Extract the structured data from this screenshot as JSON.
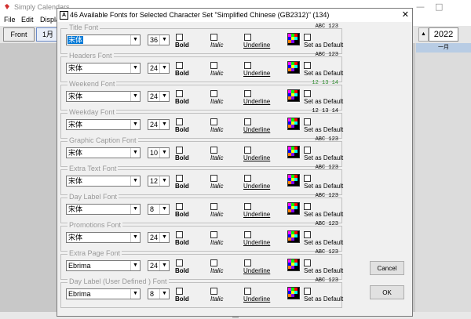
{
  "app": {
    "title": "Simply Calendars",
    "menu": [
      "File",
      "Edit",
      "Display"
    ],
    "front_label": "Front",
    "month_label": "1月",
    "year": "2022",
    "cal_header": "一月",
    "win_min": "—",
    "win_max": "□"
  },
  "dialog": {
    "title": "46 Available Fonts for Selected Character Set \"Simplified Chinese (GB2312)\" (134)",
    "icon_letter": "A",
    "close": "✕",
    "labels": {
      "bold": "Bold",
      "italic": "Italic",
      "underline": "Underline",
      "set_default": "Set as Default"
    },
    "sections": [
      {
        "name": "Title Font",
        "font": "宋体",
        "size": "36",
        "preview": "ABC 123",
        "preview_color": "#000000",
        "selected": true
      },
      {
        "name": "Headers Font",
        "font": "宋体",
        "size": "24",
        "preview": "ABC 123",
        "preview_color": "#000000",
        "selected": false
      },
      {
        "name": "Weekend Font",
        "font": "宋体",
        "size": "24",
        "preview": "12 13 14",
        "preview_color": "#2a8a2a",
        "selected": false
      },
      {
        "name": "Weekday Font",
        "font": "宋体",
        "size": "24",
        "preview": "12 13 14",
        "preview_color": "#000000",
        "selected": false
      },
      {
        "name": "Graphic Caption Font",
        "font": "宋体",
        "size": "10",
        "preview": "ABC 123",
        "preview_color": "#000000",
        "selected": false
      },
      {
        "name": "Extra Text Font",
        "font": "宋体",
        "size": "12",
        "preview": "ABC 123",
        "preview_color": "#000000",
        "selected": false
      },
      {
        "name": "Day Label Font",
        "font": "宋体",
        "size": "8",
        "preview": "ABC 123",
        "preview_color": "#000000",
        "selected": false
      },
      {
        "name": "Promotions Font",
        "font": "宋体",
        "size": "24",
        "preview": "ABC 123",
        "preview_color": "#000000",
        "selected": false
      },
      {
        "name": "Extra Page Font",
        "font": "Ebrima",
        "size": "24",
        "preview": "ABC 123",
        "preview_color": "#000000",
        "selected": false
      },
      {
        "name": "Day Label (User Defined ) Font",
        "font": "Ebrima",
        "size": "8",
        "preview": "ABC 123",
        "preview_color": "#000000",
        "selected": false
      }
    ],
    "cancel_label": "Cancel",
    "ok_label": "OK"
  }
}
